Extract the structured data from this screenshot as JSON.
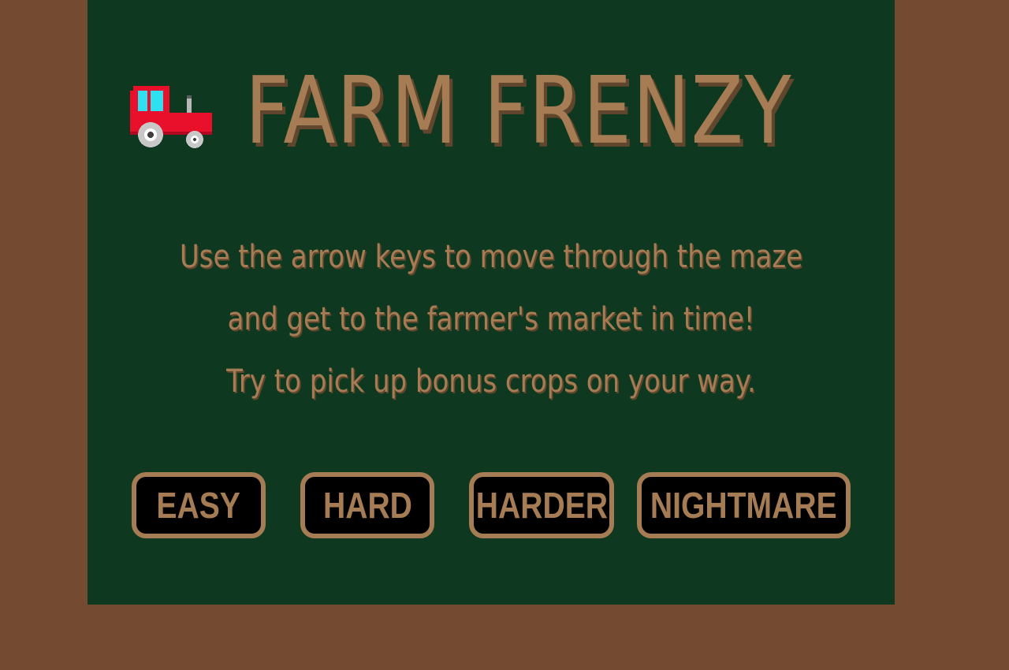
{
  "game": {
    "title": "FARM FRENZY",
    "tractor_icon": "tractor-icon",
    "instructions": [
      "Use the arrow keys to move through the maze",
      "and get to the farmer's market in time!",
      "Try to pick up bonus crops on your way."
    ]
  },
  "difficulty": {
    "easy": "EASY",
    "hard": "HARD",
    "harder": "HARDER",
    "nightmare": "NIGHTMARE"
  },
  "colors": {
    "background": "#744a30",
    "panel": "#0f3820",
    "text": "#a57c54",
    "button_bg": "#000000"
  }
}
